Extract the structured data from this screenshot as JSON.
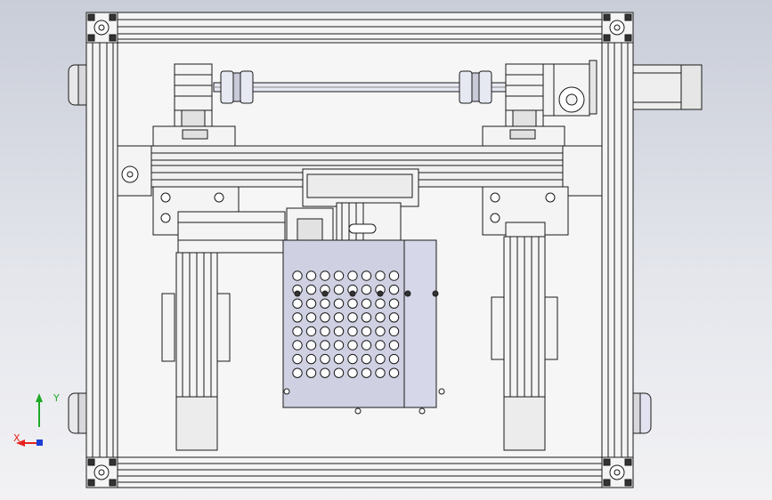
{
  "triad": {
    "x_label": "X",
    "y_label": "Y",
    "x_color": "#e8221c",
    "y_color": "#1faa28",
    "z_color": "#1d3fd6"
  },
  "colors": {
    "line": "#1a1a1a",
    "frame_fill": "#f4f4f4",
    "plate_fill": "#cfd0e2",
    "hole_fill": "#ffffff",
    "shaft_fill": "#e6e8f2",
    "motor_fill": "#eeeeee"
  },
  "tray": {
    "rows": 8,
    "cols": 8,
    "highlighted_row": 0
  }
}
